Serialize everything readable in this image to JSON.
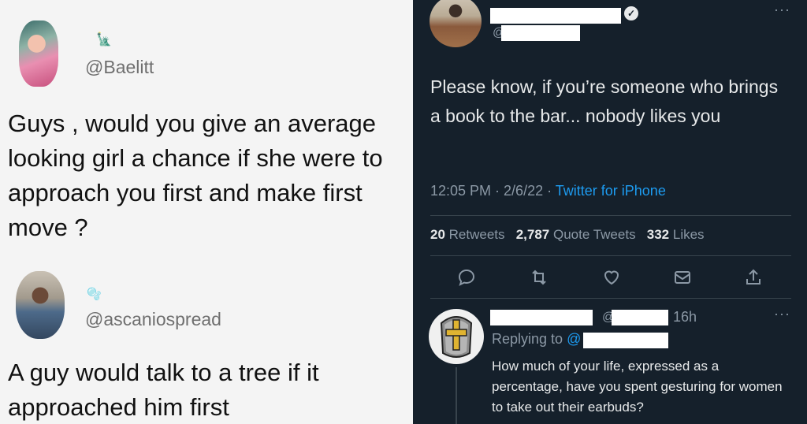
{
  "left_panel": {
    "tweet1": {
      "glyph": "🗽",
      "handle": "@Baelitt",
      "text": "Guys , would you give an average looking girl a chance if she were to approach you first and make first move ?"
    },
    "tweet2": {
      "glyph": "🫧",
      "handle": "@ascaniospread",
      "text": "A guy would talk to a tree if it approached him first"
    }
  },
  "right_panel": {
    "main_tweet": {
      "at_symbol": "@",
      "text": "Please know, if you’re someone who brings a book to the bar... nobody likes you",
      "time": "12:05 PM",
      "sep1": " · ",
      "date": "2/6/22",
      "sep2": " · ",
      "source": "Twitter for iPhone",
      "stats": {
        "retweets_count": "20",
        "retweets_label": "Retweets",
        "quotes_count": "2,787",
        "quotes_label": "Quote Tweets",
        "likes_count": "332",
        "likes_label": "Likes"
      },
      "more": "···"
    },
    "reply": {
      "at_symbol": "@",
      "time": "16h",
      "replying_to_label": "Replying to",
      "replying_to_at": "@",
      "text": "How much of your life, expressed as a percentage, have you spent gesturing for women to take out their earbuds?",
      "more": "···"
    }
  },
  "colors": {
    "dark_bg": "#15202b",
    "light_bg": "#f4f4f4",
    "link_blue": "#1d9bf0",
    "muted": "#8b98a5"
  },
  "icons": [
    "reply-icon",
    "retweet-icon",
    "like-icon",
    "share-icon",
    "share-up-icon",
    "verified-badge-icon",
    "more-icon"
  ]
}
